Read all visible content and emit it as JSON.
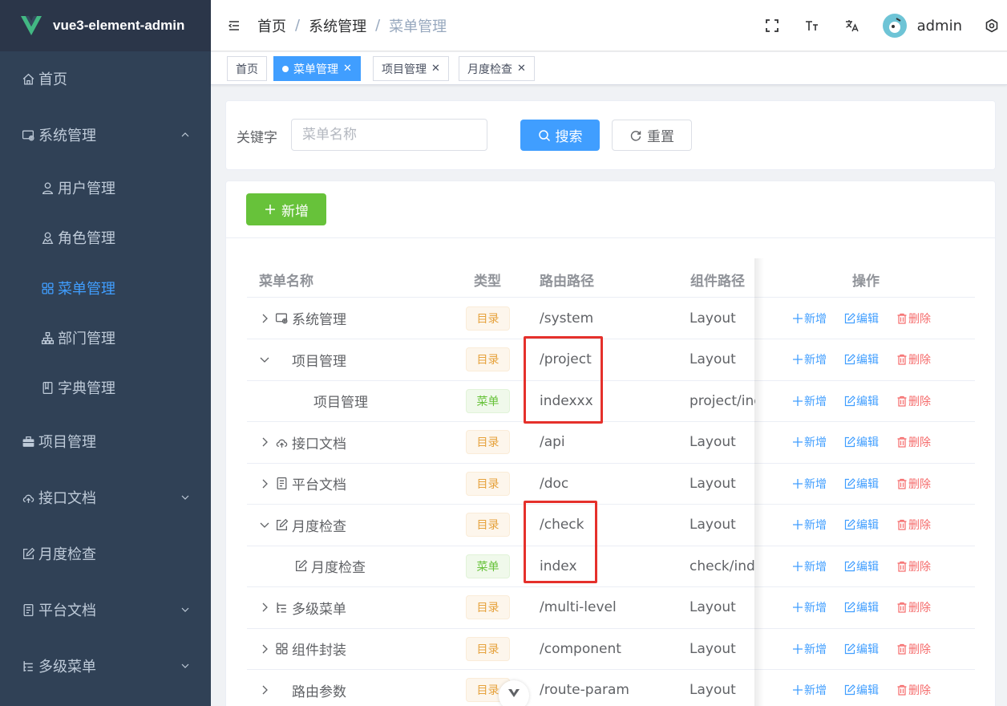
{
  "app": {
    "title": "vue3-element-admin"
  },
  "sidebar": {
    "items": [
      {
        "label": "首页",
        "icon": "home-icon"
      },
      {
        "label": "系统管理",
        "icon": "system-icon",
        "expanded": true
      },
      {
        "label": "用户管理",
        "icon": "user-icon"
      },
      {
        "label": "角色管理",
        "icon": "role-icon"
      },
      {
        "label": "菜单管理",
        "icon": "menu-icon",
        "active": true
      },
      {
        "label": "部门管理",
        "icon": "tree-icon"
      },
      {
        "label": "字典管理",
        "icon": "dict-icon"
      },
      {
        "label": "项目管理",
        "icon": "briefcase-icon"
      },
      {
        "label": "接口文档",
        "icon": "cloud-icon"
      },
      {
        "label": "月度检查",
        "icon": "edit-icon"
      },
      {
        "label": "平台文档",
        "icon": "doc-icon"
      },
      {
        "label": "多级菜单",
        "icon": "multi-level-icon"
      }
    ]
  },
  "navbar": {
    "breadcrumb": [
      "首页",
      "系统管理",
      "菜单管理"
    ],
    "username": "admin"
  },
  "tags": [
    {
      "label": "首页",
      "active": false,
      "closable": false
    },
    {
      "label": "菜单管理",
      "active": true,
      "closable": true
    },
    {
      "label": "项目管理",
      "active": false,
      "closable": true
    },
    {
      "label": "月度检查",
      "active": false,
      "closable": true
    }
  ],
  "search": {
    "label": "关键字",
    "placeholder": "菜单名称",
    "search_label": "搜索",
    "reset_label": "重置"
  },
  "table": {
    "add_label": "新增",
    "columns": [
      "菜单名称",
      "类型",
      "路由路径",
      "组件路径",
      "操作"
    ],
    "actions": {
      "add": "新增",
      "edit": "编辑",
      "delete": "删除"
    },
    "rows": [
      {
        "name": "系统管理",
        "type": "目录",
        "path": "/system",
        "component": "Layout"
      },
      {
        "name": "项目管理",
        "type": "目录",
        "path": "/project",
        "component": "Layout"
      },
      {
        "name": "项目管理",
        "type": "菜单",
        "path": "indexxx",
        "component": "project/index"
      },
      {
        "name": "接口文档",
        "type": "目录",
        "path": "/api",
        "component": "Layout"
      },
      {
        "name": "平台文档",
        "type": "目录",
        "path": "/doc",
        "component": "Layout"
      },
      {
        "name": "月度检查",
        "type": "目录",
        "path": "/check",
        "component": "Layout"
      },
      {
        "name": "月度检查",
        "type": "菜单",
        "path": "index",
        "component": "check/index"
      },
      {
        "name": "多级菜单",
        "type": "目录",
        "path": "/multi-level",
        "component": "Layout"
      },
      {
        "name": "组件封装",
        "type": "目录",
        "path": "/component",
        "component": "Layout"
      },
      {
        "name": "路由参数",
        "type": "目录",
        "path": "/route-param",
        "component": "Layout"
      }
    ]
  },
  "colors": {
    "primary": "#409eff",
    "success": "#67c23a",
    "danger": "#f56c6c",
    "warning": "#e6a23c",
    "sidebar": "#304156",
    "highlight": "#e5302b"
  }
}
